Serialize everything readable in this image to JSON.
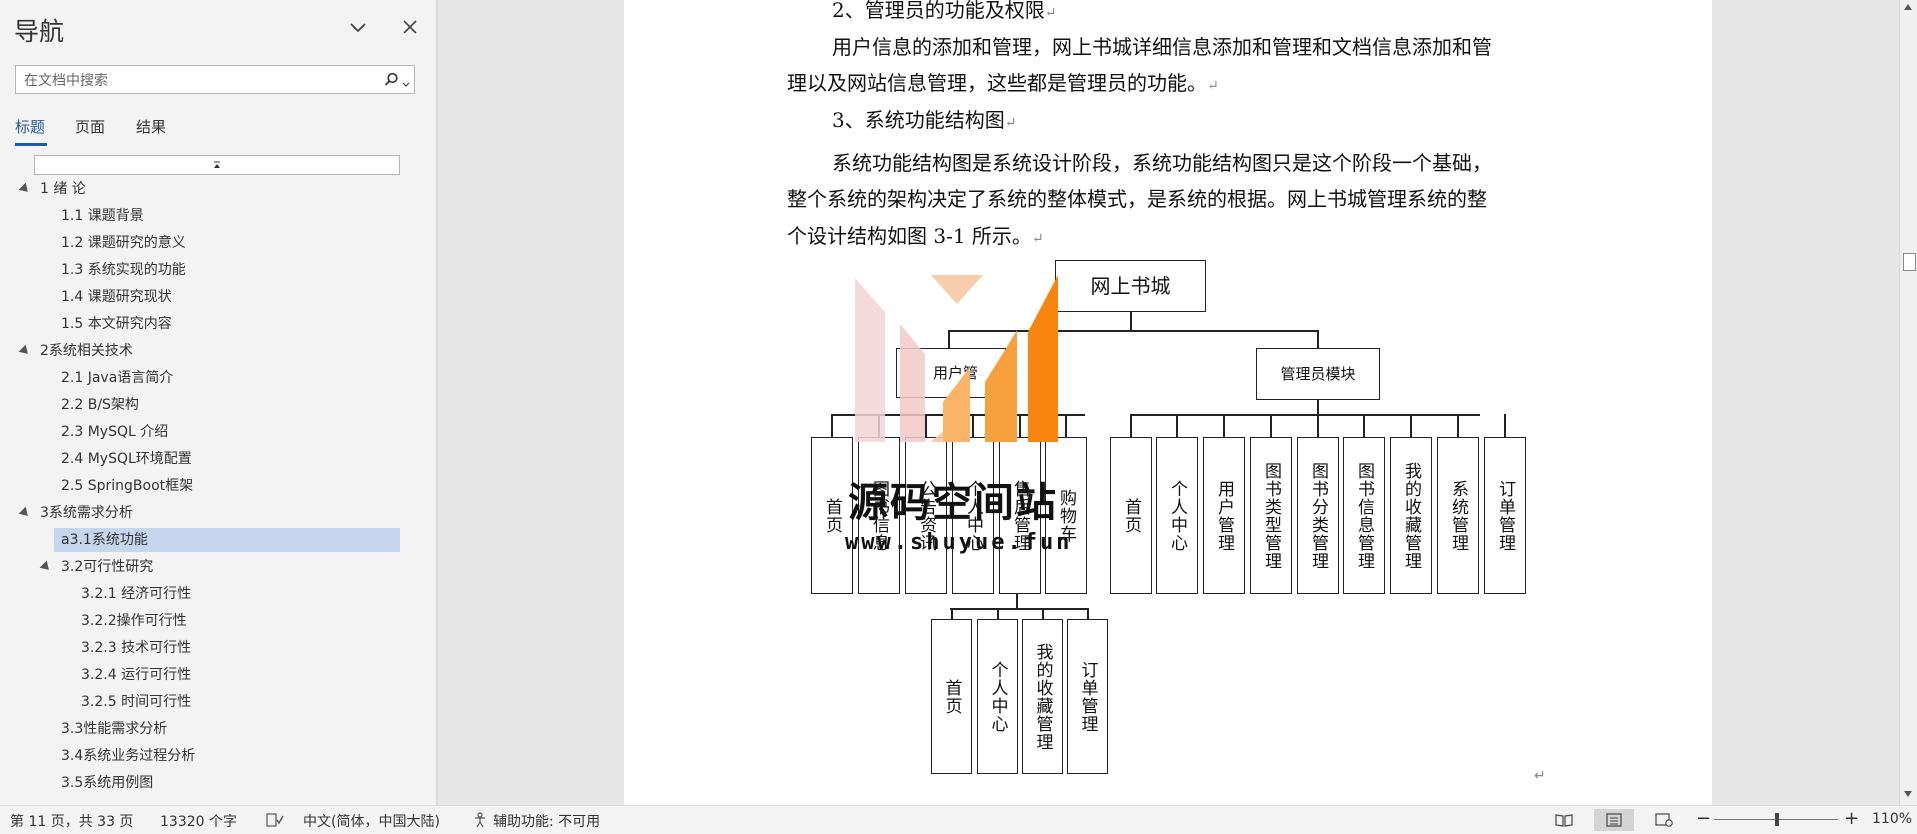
{
  "nav": {
    "title": "导航",
    "search_placeholder": "在文档中搜索",
    "tabs": {
      "headings": "标题",
      "pages": "页面",
      "results": "结果"
    },
    "items": [
      {
        "label": "1 绪 论",
        "level": 1,
        "expanded": true
      },
      {
        "label": "1.1 课题背景",
        "level": 2
      },
      {
        "label": "1.2 课题研究的意义",
        "level": 2
      },
      {
        "label": "1.3 系统实现的功能",
        "level": 2
      },
      {
        "label": "1.4 课题研究现状",
        "level": 2
      },
      {
        "label": "1.5 本文研究内容",
        "level": 2
      },
      {
        "label": "2系统相关技术",
        "level": 1,
        "expanded": true
      },
      {
        "label": "2.1 Java语言简介",
        "level": 2
      },
      {
        "label": "2.2 B/S架构",
        "level": 2
      },
      {
        "label": "2.3 MySQL 介绍",
        "level": 2
      },
      {
        "label": "2.4 MySQL环境配置",
        "level": 2
      },
      {
        "label": "2.5 SpringBoot框架",
        "level": 2
      },
      {
        "label": "3系统需求分析",
        "level": 1,
        "expanded": true
      },
      {
        "label": "a3.1系统功能",
        "level": 2,
        "selected": true
      },
      {
        "label": "3.2可行性研究",
        "level": 2,
        "expanded": true
      },
      {
        "label": "3.2.1 经济可行性",
        "level": 3
      },
      {
        "label": "3.2.2操作可行性",
        "level": 3
      },
      {
        "label": "3.2.3 技术可行性",
        "level": 3
      },
      {
        "label": "3.2.4 运行可行性",
        "level": 3
      },
      {
        "label": "3.2.5 时间可行性",
        "level": 3
      },
      {
        "label": "3.3性能需求分析",
        "level": 2
      },
      {
        "label": "3.4系统业务过程分析",
        "level": 2
      },
      {
        "label": "3.5系统用例图",
        "level": 2
      }
    ]
  },
  "doc": {
    "line1": "2、管理员的功能及权限",
    "line2": "用户信息的添加和管理，网上书城详细信息添加和管理和文档信息添加和管",
    "line3": "理以及网站信息管理，这些都是管理员的功能。",
    "line4": "3、系统功能结构图",
    "line5": "系统功能结构图是系统设计阶段，系统功能结构图只是这个阶段一个基础，",
    "line6": "整个系统的架构决定了系统的整体模式，是系统的根据。网上书城管理系统的整",
    "line7": "个设计结构如图 3-1 所示。",
    "para_mark": "↵"
  },
  "diagram": {
    "root": "网上书城",
    "user_module": "用户管",
    "admin_module": "管理员模块",
    "user_children": [
      "首页",
      "图书信息",
      "公告资讯",
      "个人中心",
      "售后管理",
      "购物车"
    ],
    "admin_children": [
      "首页",
      "个人中心",
      "用户管理",
      "图书类型管理",
      "图书分类管理",
      "图书信息管理",
      "我的收藏管理",
      "系统管理",
      "订单管理"
    ],
    "personal_children": [
      "首页",
      "个人中心",
      "我的收藏管理",
      "订单管理"
    ]
  },
  "watermark": {
    "text": "源码空间站",
    "url": "www.shuyue.fun"
  },
  "status": {
    "page": "第 11 页，共 33 页",
    "words": "13320 个字",
    "language": "中文(简体，中国大陆)",
    "accessibility": "辅助功能: 不可用",
    "zoom": "110%"
  },
  "colors": {
    "accent": "#1f5aa8",
    "selected": "#c6d6ef",
    "logo_orange": "#f7850f",
    "logo_pink": "#f2d3d3"
  }
}
